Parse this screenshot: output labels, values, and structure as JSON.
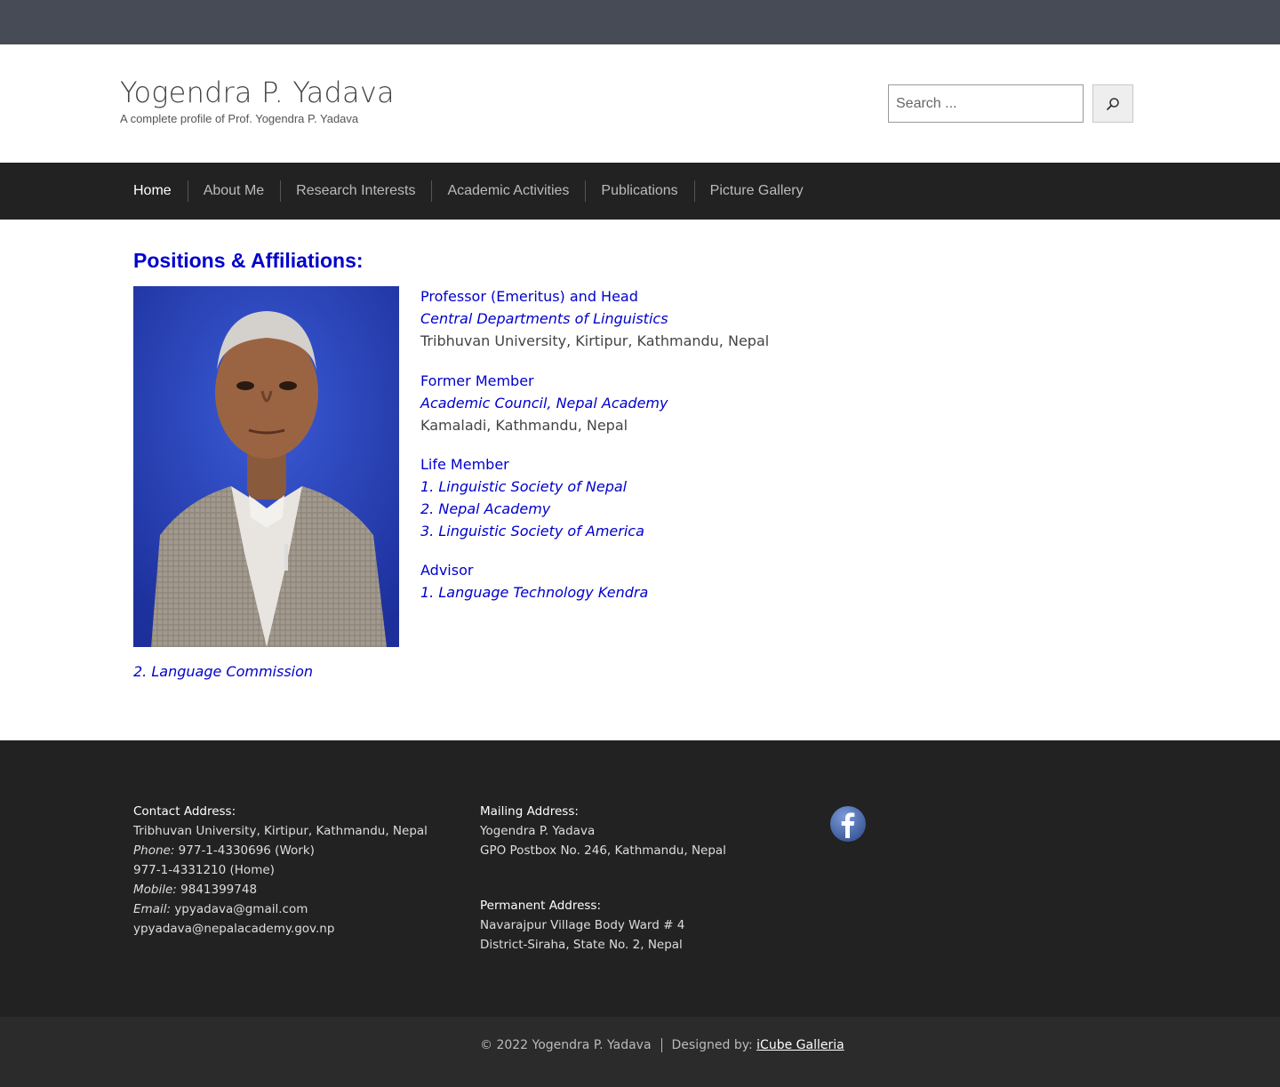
{
  "header": {
    "site_title": "Yogendra P. Yadava",
    "tagline": "A complete profile of Prof. Yogendra P. Yadava",
    "search_placeholder": "Search ..."
  },
  "nav": {
    "items": [
      {
        "label": "Home",
        "active": true
      },
      {
        "label": "About Me",
        "active": false
      },
      {
        "label": "Research Interests",
        "active": false
      },
      {
        "label": "Academic Activities",
        "active": false
      },
      {
        "label": "Publications",
        "active": false
      },
      {
        "label": "Picture Gallery",
        "active": false
      }
    ]
  },
  "main": {
    "heading": "Positions & Affiliations:",
    "affiliations": [
      {
        "title": "Professor (Emeritus) and Head",
        "italic": [
          "Central Departments of Linguistics"
        ],
        "plain": "Tribhuvan University, Kirtipur, Kathmandu, Nepal"
      },
      {
        "title": "Former Member",
        "italic": [
          "Academic Council, Nepal Academy"
        ],
        "plain": "Kamaladi, Kathmandu, Nepal"
      },
      {
        "title": "Life Member",
        "italic": [
          "1. Linguistic Society of Nepal",
          "2. Nepal Academy",
          "3. Linguistic Society of America"
        ],
        "plain": ""
      },
      {
        "title": "Advisor",
        "italic": [
          "1. Language Technology Kendra"
        ],
        "plain": ""
      }
    ],
    "advisor_extra": "2. Language Commission"
  },
  "footer": {
    "contact": {
      "heading": "Contact Address:",
      "address": "Tribhuvan University, Kirtipur, Kathmandu, Nepal",
      "phone_label": "Phone:",
      "phone_work": "977-1-4330696 (Work)",
      "phone_home": "977-1-4331210 (Home)",
      "mobile_label": "Mobile:",
      "mobile": "9841399748",
      "email_label": "Email:",
      "email_1": "ypyadava@gmail.com",
      "email_2": "ypyadava@nepalacademy.gov.np"
    },
    "mailing": {
      "heading": "Mailing Address:",
      "line_1": "Yogendra P. Yadava",
      "line_2": "GPO Postbox No. 246, Kathmandu, Nepal"
    },
    "permanent": {
      "heading": "Permanent Address:",
      "line_1": "Navarajpur Village Body Ward # 4",
      "line_2": "District-Siraha, State No. 2, Nepal"
    },
    "social_icon": "facebook-icon"
  },
  "bottom": {
    "copyright": "© 2022 Yogendra P. Yadava",
    "designed_by": "Designed by:",
    "designer": "iCube Galleria"
  },
  "colors": {
    "topbar": "#474b55",
    "nav_bg": "#222222",
    "link_blue": "#0000cc",
    "footer_bg": "#222222",
    "bottombar_bg": "#2b2b2b",
    "facebook": "#4267b2"
  }
}
